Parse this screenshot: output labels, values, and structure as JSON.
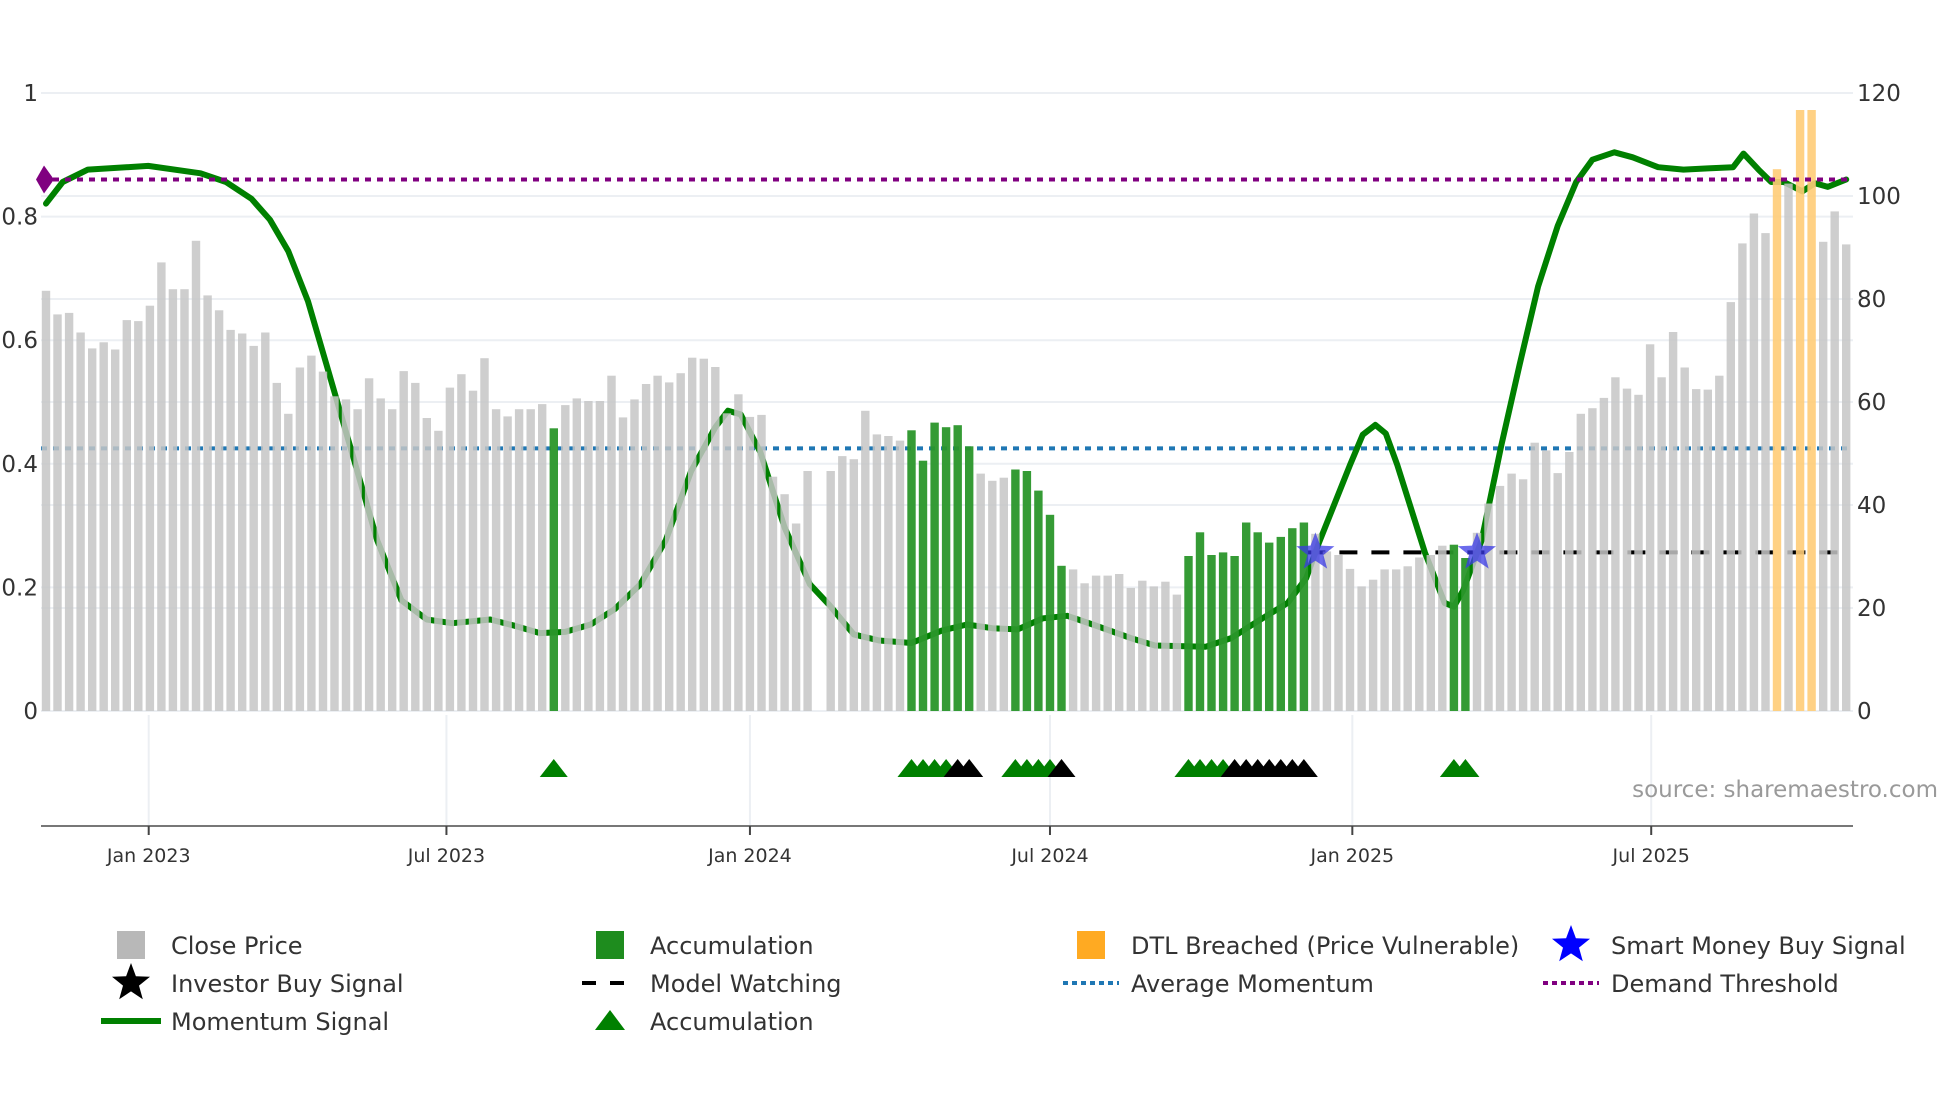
{
  "chart_data": {
    "type": "bar",
    "x_unit": "week index (1 = first bar)",
    "left_axis": {
      "ylim": [
        0,
        1
      ],
      "ticks": [
        0,
        0.2,
        0.4,
        0.6,
        0.8,
        1
      ],
      "tick_labels": [
        "0",
        "0.2",
        "0.4",
        "0.6",
        "0.8",
        "1"
      ]
    },
    "right_axis": {
      "ylim": [
        0,
        120
      ],
      "ticks": [
        0,
        20,
        40,
        60,
        80,
        100,
        120
      ],
      "tick_labels": [
        "0",
        "20",
        "40",
        "60",
        "80",
        "100",
        "120"
      ]
    },
    "x_ticks": [
      {
        "pos": 9.9,
        "label": "Jan 2023"
      },
      {
        "pos": 35.7,
        "label": "Jul 2023"
      },
      {
        "pos": 62.0,
        "label": "Jan 2024"
      },
      {
        "pos": 88.0,
        "label": "Jul 2024"
      },
      {
        "pos": 114.2,
        "label": "Jan 2025"
      },
      {
        "pos": 140.1,
        "label": "Jul 2025"
      }
    ],
    "grid": true,
    "close_price": [
      81.6,
      77,
      77.3,
      73.5,
      70.4,
      71.6,
      70.2,
      75.9,
      75.7,
      78.7,
      87.1,
      81.9,
      81.9,
      91.3,
      80.7,
      77.8,
      74,
      73.3,
      70.9,
      73.5,
      63.7,
      57.7,
      66.7,
      69,
      65.9,
      61.1,
      60.5,
      58.6,
      64.6,
      60.7,
      58.6,
      66,
      63.7,
      56.9,
      54.4,
      62.8,
      65.4,
      62.2,
      68.5,
      58.6,
      57.2,
      58.6,
      58.6,
      59.6,
      54.9,
      59.4,
      60.7,
      60.2,
      60.2,
      65.1,
      57,
      60.5,
      63.5,
      65.1,
      63.8,
      65.6,
      68.6,
      68.4,
      66.8,
      57.8,
      61.5,
      57.1,
      57.5,
      45.5,
      42.1,
      36.4,
      46.6,
      null,
      46.6,
      49.5,
      48.9,
      58.3,
      53.7,
      53.4,
      52.5,
      54.5,
      48.6,
      56,
      55.1,
      55.5,
      51.4,
      46.1,
      44.7,
      45.3,
      46.9,
      46.6,
      42.8,
      38.1,
      28.2,
      27.5,
      24.8,
      26.3,
      26.3,
      26.6,
      23.9,
      25.3,
      24.2,
      25.1,
      22.6,
      30.1,
      34.7,
      30.3,
      30.8,
      30.1,
      36.6,
      34.7,
      32.7,
      33.8,
      35.5,
      36.6,
      34.4,
      31,
      30.3,
      27.6,
      24.2,
      25.5,
      27.5,
      27.5,
      28.1,
      29.8,
      30.3,
      32.1,
      32.3,
      29.7,
      34.6,
      40.3,
      43.7,
      46.1,
      45,
      52.1,
      50.6,
      46.2,
      50.3,
      57.7,
      58.8,
      60.8,
      64.8,
      62.6,
      61.4,
      71.2,
      64.8,
      73.6,
      66.7,
      62.5,
      62.4,
      65.1,
      79.4,
      90.8,
      96.6,
      92.8,
      105.2,
      102.4,
      116.7,
      116.7,
      91.1,
      97,
      90.6
    ],
    "accumulation_bars": [
      45,
      76,
      77,
      78,
      79,
      80,
      81,
      85,
      86,
      87,
      88,
      89,
      100,
      101,
      102,
      103,
      104,
      105,
      106,
      107,
      108,
      109,
      110,
      123,
      124
    ],
    "dtl_breached_bars": [
      151,
      153,
      154
    ],
    "momentum_signal": [
      [
        1,
        0.821
      ],
      [
        2.45,
        0.856
      ],
      [
        4.63,
        0.876
      ],
      [
        9.86,
        0.882
      ],
      [
        14.4,
        0.87
      ],
      [
        16.6,
        0.856
      ],
      [
        18.8,
        0.829
      ],
      [
        20.4,
        0.795
      ],
      [
        22,
        0.744
      ],
      [
        23.7,
        0.663
      ],
      [
        25.3,
        0.561
      ],
      [
        27.5,
        0.419
      ],
      [
        29.7,
        0.276
      ],
      [
        31.8,
        0.179
      ],
      [
        34,
        0.148
      ],
      [
        36.2,
        0.142
      ],
      [
        39.5,
        0.148
      ],
      [
        41.6,
        0.138
      ],
      [
        43.8,
        0.126
      ],
      [
        46,
        0.128
      ],
      [
        48.2,
        0.14
      ],
      [
        50.3,
        0.165
      ],
      [
        52.5,
        0.205
      ],
      [
        54.7,
        0.276
      ],
      [
        56.9,
        0.388
      ],
      [
        59,
        0.459
      ],
      [
        60.1,
        0.486
      ],
      [
        61.2,
        0.48
      ],
      [
        62.9,
        0.419
      ],
      [
        65,
        0.297
      ],
      [
        67.2,
        0.205
      ],
      [
        68.9,
        0.171
      ],
      [
        71,
        0.124
      ],
      [
        73.2,
        0.114
      ],
      [
        76,
        0.11
      ],
      [
        78.6,
        0.13
      ],
      [
        80.8,
        0.14
      ],
      [
        83,
        0.134
      ],
      [
        85.2,
        0.132
      ],
      [
        87.4,
        0.15
      ],
      [
        89.5,
        0.154
      ],
      [
        91.7,
        0.14
      ],
      [
        95,
        0.118
      ],
      [
        97.1,
        0.106
      ],
      [
        101.5,
        0.104
      ],
      [
        103.7,
        0.118
      ],
      [
        105.9,
        0.144
      ],
      [
        108.6,
        0.175
      ],
      [
        110.2,
        0.215
      ],
      [
        111.3,
        0.272
      ],
      [
        114,
        0.398
      ],
      [
        115.1,
        0.447
      ],
      [
        116.2,
        0.463
      ],
      [
        117.1,
        0.449
      ],
      [
        118.1,
        0.398
      ],
      [
        120.5,
        0.256
      ],
      [
        122.2,
        0.175
      ],
      [
        123,
        0.169
      ],
      [
        123.8,
        0.195
      ],
      [
        125.4,
        0.276
      ],
      [
        127.1,
        0.429
      ],
      [
        128.7,
        0.561
      ],
      [
        130.3,
        0.687
      ],
      [
        132,
        0.785
      ],
      [
        133.6,
        0.856
      ],
      [
        135,
        0.892
      ],
      [
        136.9,
        0.904
      ],
      [
        138.5,
        0.896
      ],
      [
        140.7,
        0.88
      ],
      [
        142.9,
        0.876
      ],
      [
        145,
        0.878
      ],
      [
        147.2,
        0.88
      ],
      [
        148.1,
        0.902
      ],
      [
        149.4,
        0.876
      ],
      [
        150.5,
        0.856
      ],
      [
        151.6,
        0.856
      ],
      [
        153.2,
        0.841
      ],
      [
        154.3,
        0.854
      ],
      [
        155.4,
        0.848
      ],
      [
        157,
        0.86
      ]
    ],
    "average_momentum": 0.425,
    "demand_threshold": 0.86,
    "model_watching": {
      "price": 30.8,
      "from": 111,
      "to": 157
    },
    "smart_money_buy_signals": [
      {
        "x": 111,
        "price": 30.8
      },
      {
        "x": 125,
        "price": 30.8
      }
    ],
    "demand_marker": {
      "x": 1,
      "value": 0.86
    },
    "accumulation_triangles": [
      45,
      76,
      77,
      78,
      79,
      85,
      86,
      87,
      88,
      100,
      101,
      102,
      103,
      123,
      124
    ],
    "black_triangles": [
      80,
      81,
      89,
      104,
      105,
      106,
      107,
      108,
      109,
      110
    ],
    "source_note": "source: sharemaestro.com",
    "legend": [
      {
        "label": "Close Price",
        "icon": "square",
        "color": "#b8b8b8"
      },
      {
        "label": "Accumulation",
        "icon": "square",
        "color": "#1e8c1e"
      },
      {
        "label": "DTL Breached (Price Vulnerable)",
        "icon": "square",
        "color": "#ffaa22"
      },
      {
        "label": "Smart Money Buy Signal",
        "icon": "star",
        "color": "#0000ff"
      },
      {
        "label": "Investor Buy Signal",
        "icon": "star",
        "color": "#000000"
      },
      {
        "label": "Model Watching",
        "icon": "dash",
        "color": "#000000"
      },
      {
        "label": "Average Momentum",
        "icon": "dot",
        "color": "#1f77b4"
      },
      {
        "label": "Demand Threshold",
        "icon": "dot",
        "color": "#800080"
      },
      {
        "label": "Momentum Signal",
        "icon": "line",
        "color": "#008000"
      },
      {
        "label": "Accumulation",
        "icon": "triangle",
        "color": "#008000"
      }
    ],
    "colors": {
      "close": "#c6c6c6",
      "accum": "#2a962a",
      "dtl": "#ffcc77",
      "momentum": "#008000",
      "avg": "#1f77b4",
      "demand": "#800080",
      "watch": "#000000",
      "star": "#3a3ae6",
      "grid": "#eceff3"
    }
  }
}
